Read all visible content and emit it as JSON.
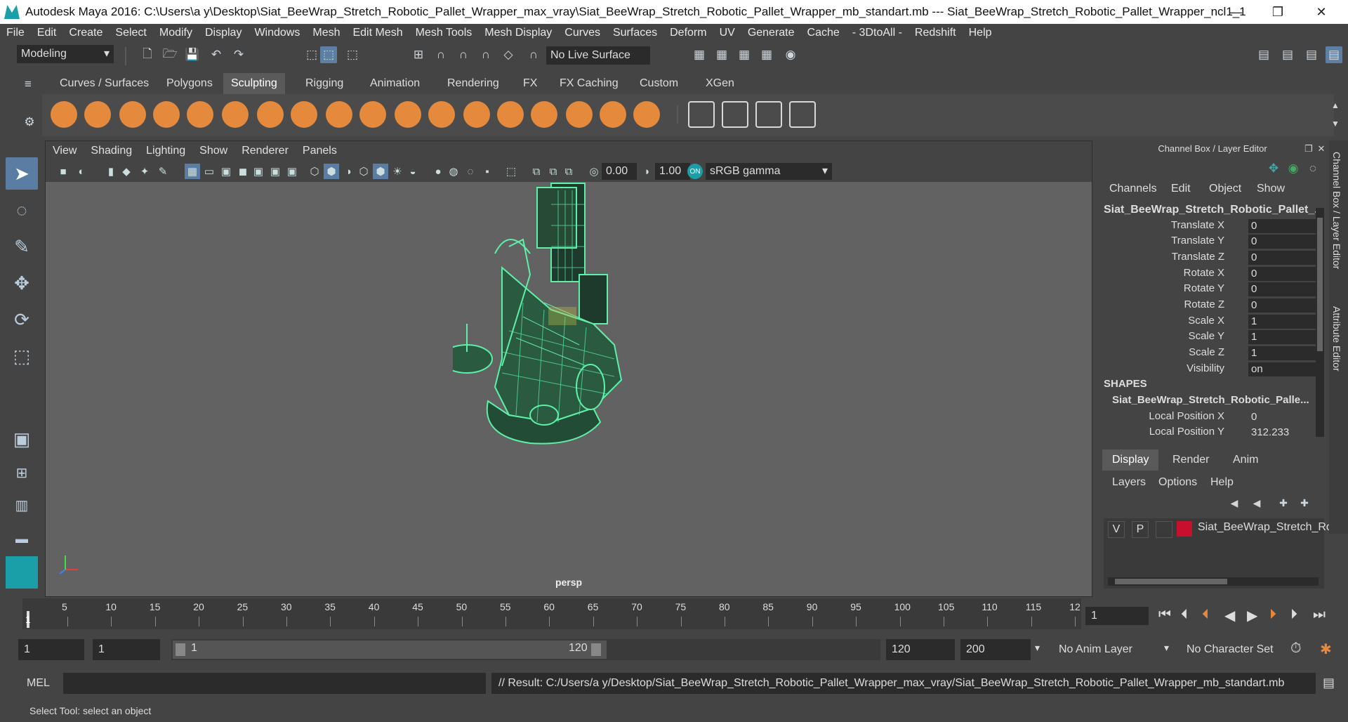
{
  "titlebar": {
    "title": "Autodesk Maya 2016: C:\\Users\\a y\\Desktop\\Siat_BeeWrap_Stretch_Robotic_Pallet_Wrapper_max_vray\\Siat_BeeWrap_Stretch_Robotic_Pallet_Wrapper_mb_standart.mb   ---   Siat_BeeWrap_Stretch_Robotic_Pallet_Wrapper_ncl1_1",
    "minimize": "—",
    "restore": "❐",
    "close": "✕"
  },
  "menubar": [
    "File",
    "Edit",
    "Create",
    "Select",
    "Modify",
    "Display",
    "Windows",
    "Mesh",
    "Edit Mesh",
    "Mesh Tools",
    "Mesh Display",
    "Curves",
    "Surfaces",
    "Deform",
    "UV",
    "Generate",
    "Cache",
    "- 3DtoAll -",
    "Redshift",
    "Help"
  ],
  "statusline": {
    "mode": "Modeling",
    "live_surface": "No Live Surface"
  },
  "shelf": {
    "tabs": [
      "Curves / Surfaces",
      "Polygons",
      "Sculpting",
      "Rigging",
      "Animation",
      "Rendering",
      "FX",
      "FX Caching",
      "Custom",
      "XGen"
    ],
    "active_tab": "Sculpting"
  },
  "viewport": {
    "menus": [
      "View",
      "Shading",
      "Lighting",
      "Show",
      "Renderer",
      "Panels"
    ],
    "exposure": "0.00",
    "gamma": "1.00",
    "color_space": "sRGB gamma",
    "camera": "persp"
  },
  "channel_box": {
    "header": "Channel Box / Layer Editor",
    "menus": [
      "Channels",
      "Edit",
      "Object",
      "Show"
    ],
    "object_name": "Siat_BeeWrap_Stretch_Robotic_Pallet_...",
    "channels": [
      {
        "name": "Translate X",
        "value": "0"
      },
      {
        "name": "Translate Y",
        "value": "0"
      },
      {
        "name": "Translate Z",
        "value": "0"
      },
      {
        "name": "Rotate X",
        "value": "0"
      },
      {
        "name": "Rotate Y",
        "value": "0"
      },
      {
        "name": "Rotate Z",
        "value": "0"
      },
      {
        "name": "Scale X",
        "value": "1"
      },
      {
        "name": "Scale Y",
        "value": "1"
      },
      {
        "name": "Scale Z",
        "value": "1"
      },
      {
        "name": "Visibility",
        "value": "on"
      }
    ],
    "shapes_label": "SHAPES",
    "shape_name": "Siat_BeeWrap_Stretch_Robotic_Palle...",
    "shape_channels": [
      {
        "name": "Local Position X",
        "value": "0"
      },
      {
        "name": "Local Position Y",
        "value": "312.233"
      }
    ]
  },
  "layer_editor": {
    "tabs": [
      "Display",
      "Render",
      "Anim"
    ],
    "active_tab": "Display",
    "menus": [
      "Layers",
      "Options",
      "Help"
    ],
    "layer": {
      "v": "V",
      "p": "P",
      "name": "Siat_BeeWrap_Stretch_Ro",
      "color": "#c8102e"
    }
  },
  "side_tabs": [
    "Channel Box / Layer Editor",
    "Attribute Editor"
  ],
  "timeline": {
    "ticks": [
      "1",
      "5",
      "10",
      "15",
      "20",
      "25",
      "30",
      "35",
      "40",
      "45",
      "50",
      "55",
      "60",
      "65",
      "70",
      "75",
      "80",
      "85",
      "90",
      "95",
      "100",
      "105",
      "110",
      "115",
      "12"
    ],
    "current_frame": "1"
  },
  "range": {
    "start": "1",
    "playback_start": "1",
    "slider_start": "1",
    "slider_end": "120",
    "playback_end": "120",
    "end": "200",
    "anim_layer": "No Anim Layer",
    "character_set": "No Character Set"
  },
  "command_line": {
    "lang": "MEL",
    "result": "// Result: C:/Users/a y/Desktop/Siat_BeeWrap_Stretch_Robotic_Pallet_Wrapper_max_vray/Siat_BeeWrap_Stretch_Robotic_Pallet_Wrapper_mb_standart.mb"
  },
  "help_line": "Select Tool: select an object",
  "colors": {
    "accent": "#5b7da3",
    "wireframe": "#5ef0a8",
    "layer_color": "#c8102e"
  }
}
